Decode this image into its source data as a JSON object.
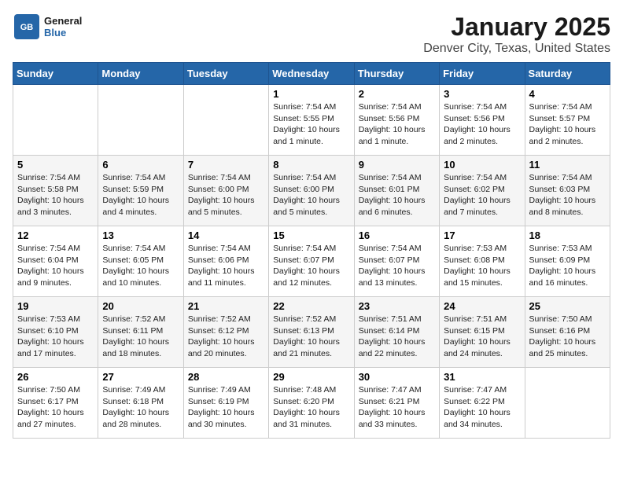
{
  "header": {
    "logo_general": "General",
    "logo_blue": "Blue",
    "title": "January 2025",
    "subtitle": "Denver City, Texas, United States"
  },
  "days_of_week": [
    "Sunday",
    "Monday",
    "Tuesday",
    "Wednesday",
    "Thursday",
    "Friday",
    "Saturday"
  ],
  "weeks": [
    [
      {
        "day": "",
        "info": ""
      },
      {
        "day": "",
        "info": ""
      },
      {
        "day": "",
        "info": ""
      },
      {
        "day": "1",
        "info": "Sunrise: 7:54 AM\nSunset: 5:55 PM\nDaylight: 10 hours\nand 1 minute."
      },
      {
        "day": "2",
        "info": "Sunrise: 7:54 AM\nSunset: 5:56 PM\nDaylight: 10 hours\nand 1 minute."
      },
      {
        "day": "3",
        "info": "Sunrise: 7:54 AM\nSunset: 5:56 PM\nDaylight: 10 hours\nand 2 minutes."
      },
      {
        "day": "4",
        "info": "Sunrise: 7:54 AM\nSunset: 5:57 PM\nDaylight: 10 hours\nand 2 minutes."
      }
    ],
    [
      {
        "day": "5",
        "info": "Sunrise: 7:54 AM\nSunset: 5:58 PM\nDaylight: 10 hours\nand 3 minutes."
      },
      {
        "day": "6",
        "info": "Sunrise: 7:54 AM\nSunset: 5:59 PM\nDaylight: 10 hours\nand 4 minutes."
      },
      {
        "day": "7",
        "info": "Sunrise: 7:54 AM\nSunset: 6:00 PM\nDaylight: 10 hours\nand 5 minutes."
      },
      {
        "day": "8",
        "info": "Sunrise: 7:54 AM\nSunset: 6:00 PM\nDaylight: 10 hours\nand 5 minutes."
      },
      {
        "day": "9",
        "info": "Sunrise: 7:54 AM\nSunset: 6:01 PM\nDaylight: 10 hours\nand 6 minutes."
      },
      {
        "day": "10",
        "info": "Sunrise: 7:54 AM\nSunset: 6:02 PM\nDaylight: 10 hours\nand 7 minutes."
      },
      {
        "day": "11",
        "info": "Sunrise: 7:54 AM\nSunset: 6:03 PM\nDaylight: 10 hours\nand 8 minutes."
      }
    ],
    [
      {
        "day": "12",
        "info": "Sunrise: 7:54 AM\nSunset: 6:04 PM\nDaylight: 10 hours\nand 9 minutes."
      },
      {
        "day": "13",
        "info": "Sunrise: 7:54 AM\nSunset: 6:05 PM\nDaylight: 10 hours\nand 10 minutes."
      },
      {
        "day": "14",
        "info": "Sunrise: 7:54 AM\nSunset: 6:06 PM\nDaylight: 10 hours\nand 11 minutes."
      },
      {
        "day": "15",
        "info": "Sunrise: 7:54 AM\nSunset: 6:07 PM\nDaylight: 10 hours\nand 12 minutes."
      },
      {
        "day": "16",
        "info": "Sunrise: 7:54 AM\nSunset: 6:07 PM\nDaylight: 10 hours\nand 13 minutes."
      },
      {
        "day": "17",
        "info": "Sunrise: 7:53 AM\nSunset: 6:08 PM\nDaylight: 10 hours\nand 15 minutes."
      },
      {
        "day": "18",
        "info": "Sunrise: 7:53 AM\nSunset: 6:09 PM\nDaylight: 10 hours\nand 16 minutes."
      }
    ],
    [
      {
        "day": "19",
        "info": "Sunrise: 7:53 AM\nSunset: 6:10 PM\nDaylight: 10 hours\nand 17 minutes."
      },
      {
        "day": "20",
        "info": "Sunrise: 7:52 AM\nSunset: 6:11 PM\nDaylight: 10 hours\nand 18 minutes."
      },
      {
        "day": "21",
        "info": "Sunrise: 7:52 AM\nSunset: 6:12 PM\nDaylight: 10 hours\nand 20 minutes."
      },
      {
        "day": "22",
        "info": "Sunrise: 7:52 AM\nSunset: 6:13 PM\nDaylight: 10 hours\nand 21 minutes."
      },
      {
        "day": "23",
        "info": "Sunrise: 7:51 AM\nSunset: 6:14 PM\nDaylight: 10 hours\nand 22 minutes."
      },
      {
        "day": "24",
        "info": "Sunrise: 7:51 AM\nSunset: 6:15 PM\nDaylight: 10 hours\nand 24 minutes."
      },
      {
        "day": "25",
        "info": "Sunrise: 7:50 AM\nSunset: 6:16 PM\nDaylight: 10 hours\nand 25 minutes."
      }
    ],
    [
      {
        "day": "26",
        "info": "Sunrise: 7:50 AM\nSunset: 6:17 PM\nDaylight: 10 hours\nand 27 minutes."
      },
      {
        "day": "27",
        "info": "Sunrise: 7:49 AM\nSunset: 6:18 PM\nDaylight: 10 hours\nand 28 minutes."
      },
      {
        "day": "28",
        "info": "Sunrise: 7:49 AM\nSunset: 6:19 PM\nDaylight: 10 hours\nand 30 minutes."
      },
      {
        "day": "29",
        "info": "Sunrise: 7:48 AM\nSunset: 6:20 PM\nDaylight: 10 hours\nand 31 minutes."
      },
      {
        "day": "30",
        "info": "Sunrise: 7:47 AM\nSunset: 6:21 PM\nDaylight: 10 hours\nand 33 minutes."
      },
      {
        "day": "31",
        "info": "Sunrise: 7:47 AM\nSunset: 6:22 PM\nDaylight: 10 hours\nand 34 minutes."
      },
      {
        "day": "",
        "info": ""
      }
    ]
  ]
}
